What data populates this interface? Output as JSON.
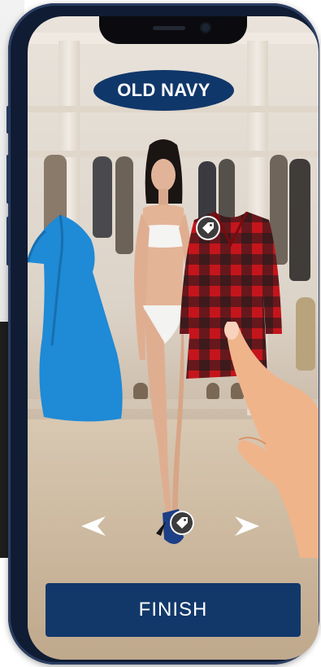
{
  "brand": {
    "logo_text": "OLD NAVY",
    "color": "#10376a"
  },
  "icons": {
    "tag_shirt": "price-tag-icon",
    "tag_shoe": "price-tag-icon",
    "prev": "chevron-left-icon",
    "next": "chevron-right-icon"
  },
  "actions": {
    "finish_label": "FINISH"
  },
  "colors": {
    "button_bg": "#12386a",
    "dress": "#1f8ad6",
    "plaid_red": "#c4151c",
    "plaid_dark": "#1c1c1c"
  }
}
